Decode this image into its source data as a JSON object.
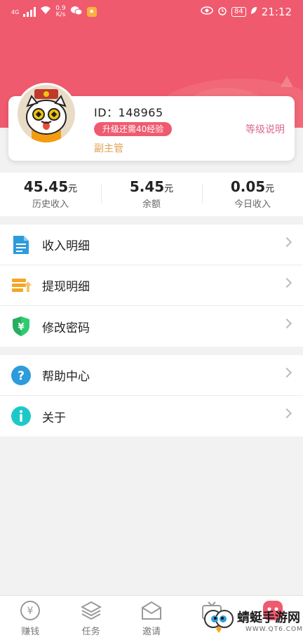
{
  "status_bar": {
    "signal": "4G",
    "speed": "0.9\nK/s",
    "battery": "84",
    "time": "21:12"
  },
  "profile": {
    "user_id": "ID：148965",
    "upgrade_badge": "升级还需40经验",
    "role": "副主管",
    "level_info": "等级说明"
  },
  "stats": [
    {
      "value": "45.45",
      "unit": "元",
      "label": "历史收入"
    },
    {
      "value": "5.45",
      "unit": "元",
      "label": "余额"
    },
    {
      "value": "0.05",
      "unit": "元",
      "label": "今日收入"
    }
  ],
  "menu_group1": [
    {
      "label": "收入明细",
      "icon": "document-icon"
    },
    {
      "label": "提现明细",
      "icon": "withdraw-icon"
    },
    {
      "label": "修改密码",
      "icon": "shield-yen-icon"
    }
  ],
  "menu_group2": [
    {
      "label": "帮助中心",
      "icon": "question-icon"
    },
    {
      "label": "关于",
      "icon": "info-icon"
    }
  ],
  "tabs": [
    {
      "label": "赚钱",
      "icon": "yen-coin-icon"
    },
    {
      "label": "任务",
      "icon": "layers-icon"
    },
    {
      "label": "邀请",
      "icon": "envelope-icon"
    },
    {
      "label": "",
      "icon": "tv-icon"
    },
    {
      "label": "",
      "icon": "mine-icon"
    }
  ],
  "watermark": {
    "text": "蜻蜓手游网",
    "url": "WWW.QT6.COM"
  },
  "colors": {
    "header": "#ef5a6f",
    "accent": "#ef5a6f",
    "role": "#e0a050",
    "level_link": "#d96b8a"
  }
}
